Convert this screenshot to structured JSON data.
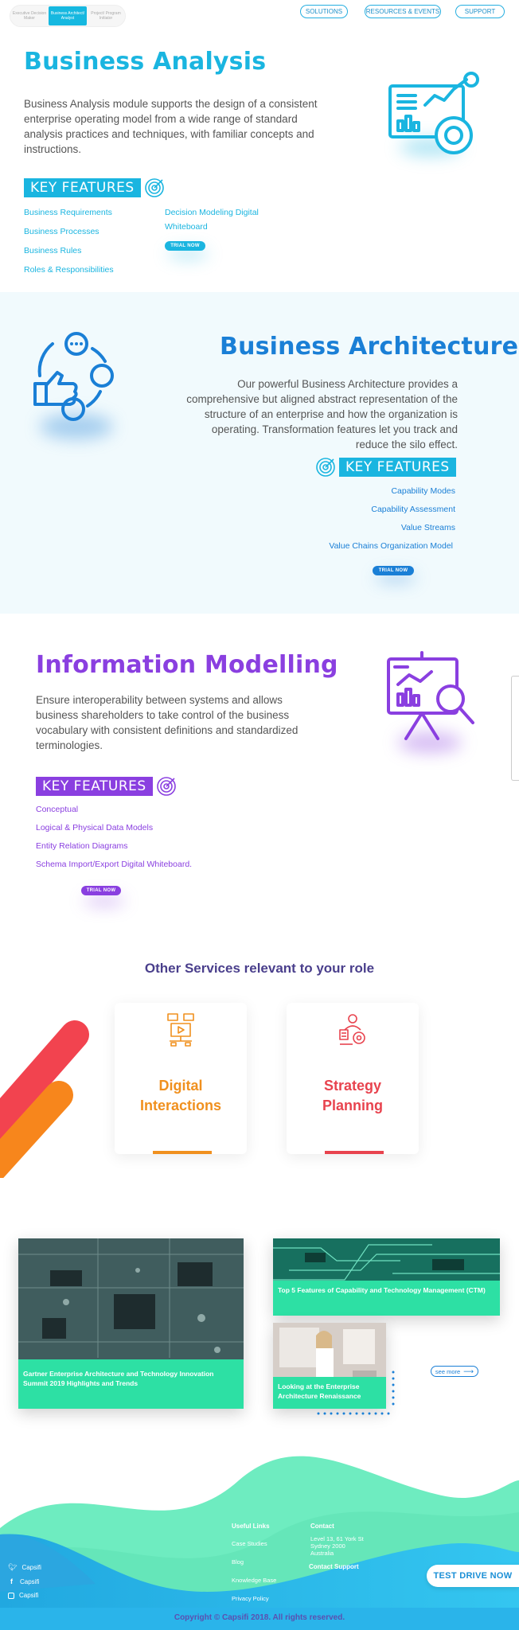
{
  "topbar": {
    "roles": [
      "Executive Decision Maker",
      "Business Architect/ Analyst",
      "Project/ Program Initiator"
    ],
    "nav": [
      "SOLUTIONS",
      "RESOURCES & EVENTS",
      "SUPPORT"
    ]
  },
  "ba": {
    "title": "Business Analysis",
    "text": "Business Analysis module supports the design of a consistent enterprise operating model from a wide range of standard analysis practices and techniques, with familiar concepts and instructions.",
    "kf": "KEY FEATURES",
    "features_left": [
      "Business Requirements",
      "Business Processes",
      "Business Rules",
      "Roles & Responsibilities"
    ],
    "features_right": [
      "Decision Modeling Digital",
      "Whiteboard"
    ],
    "trial": "TRIAL NOW",
    "color": "#1ab5e0"
  },
  "barch": {
    "title": "Business Architecture",
    "text": "Our powerful Business Architecture provides a comprehensive but aligned abstract representation of the structure of an enterprise and how the organization is operating. Transformation features let you track and reduce the silo effect.",
    "kf": "KEY FEATURES",
    "features": [
      "Capability Modes",
      "Capability Assessment",
      "Value Streams",
      "Value Chains Organization Model"
    ],
    "trial": "TRIAL NOW",
    "color": "#1a7fd6"
  },
  "info": {
    "title": "Information Modelling",
    "text": "Ensure interoperability between systems and allows business shareholders to take control of the business vocabulary with consistent definitions and standardized terminologies.",
    "kf": "KEY FEATURES",
    "features": [
      "Conceptual",
      "Logical & Physical Data Models",
      "Entity Relation Diagrams",
      "Schema Import/Export Digital Whiteboard."
    ],
    "trial": "TRIAL NOW",
    "color": "#8a3fe0"
  },
  "services": {
    "heading": "Other Services relevant to your role",
    "cards": [
      {
        "title1": "Digital",
        "title2": "Interactions",
        "color": "#f0901e"
      },
      {
        "title1": "Strategy",
        "title2": "Planning",
        "color": "#e8434e"
      }
    ]
  },
  "news": {
    "items": [
      "Gartner Enterprise Architecture and Technology Innovation Summit 2019 Highlights and Trends",
      "Top 5 Features of Capability and Technology Management (CTM)",
      "Looking at the Enterprise Architecture Renaissance"
    ],
    "see_more": "see more"
  },
  "footer": {
    "social": [
      "Capsifi",
      "Capsifi",
      "Capsifi"
    ],
    "useful_title": "Useful Links",
    "useful": [
      "Case Studies",
      "Blog",
      "Knowledge Base",
      "Privacy Policy"
    ],
    "contact_title": "Contact",
    "address1": "Level 13, 61 York St",
    "address2": "Sydney 2000",
    "address3": "Australia",
    "support": "Contact Support",
    "test_drive": "TEST DRIVE NOW",
    "copyright": "Copyright © Capsifi 2018. All rights reserved."
  }
}
